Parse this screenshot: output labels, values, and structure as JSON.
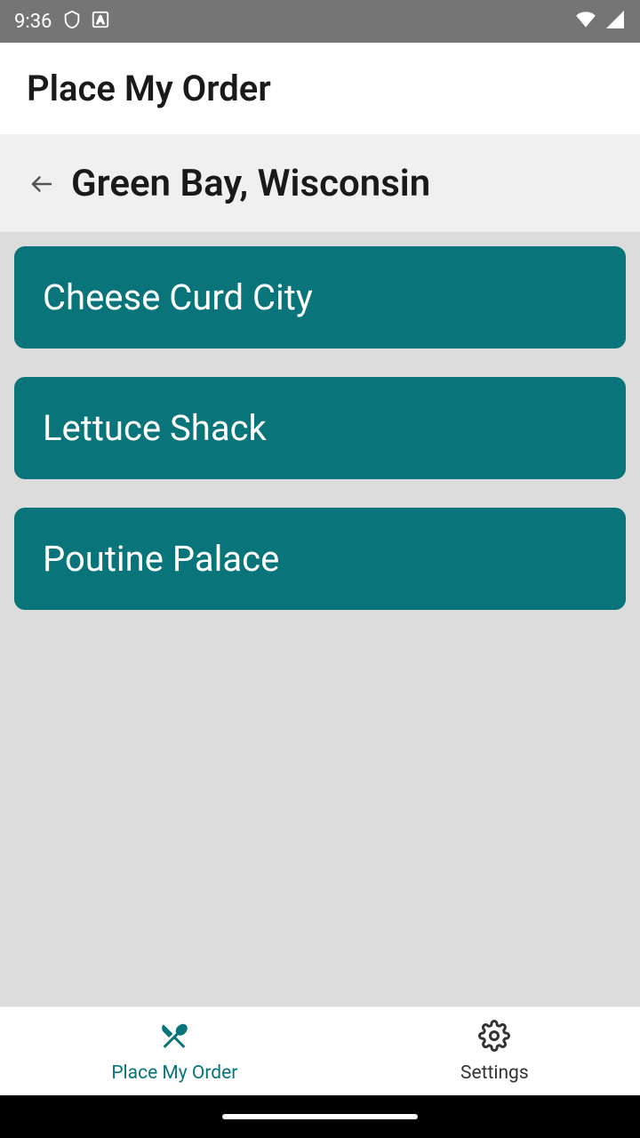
{
  "statusBar": {
    "time": "9:36"
  },
  "appHeader": {
    "title": "Place My Order"
  },
  "locationHeader": {
    "title": "Green Bay, Wisconsin"
  },
  "restaurants": [
    {
      "name": "Cheese Curd City"
    },
    {
      "name": "Lettuce Shack"
    },
    {
      "name": "Poutine Palace"
    }
  ],
  "bottomNav": {
    "order": "Place My Order",
    "settings": "Settings"
  },
  "colors": {
    "accent": "#09757a"
  }
}
